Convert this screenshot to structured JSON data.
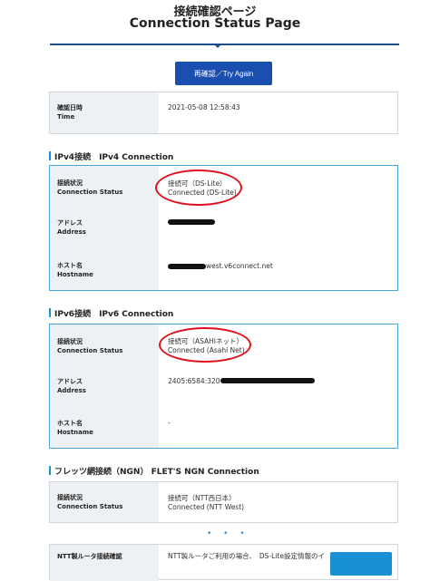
{
  "header": {
    "title_ja": "接続確認ページ",
    "title_en": "Connection Status Page"
  },
  "retry_button": {
    "label": "再確認／Try Again"
  },
  "datetime": {
    "label_ja": "確認日時",
    "label_en": "Time",
    "value": "2021-05-08 12:58:43"
  },
  "ipv4": {
    "section_title": "IPv4接続　IPv4 Connection",
    "status": {
      "label_ja": "接続状況",
      "label_en": "Connection Status",
      "value_ja": "接続可（DS-Lite）",
      "value_en": "Connected (DS-Lite)"
    },
    "address": {
      "label_ja": "アドレス",
      "label_en": "Address",
      "value": ""
    },
    "host": {
      "label_ja": "ホスト名",
      "label_en": "Hostname",
      "value_suffix": "west.v6connect.net"
    }
  },
  "ipv6": {
    "section_title": "IPv6接続　IPv6 Connection",
    "status": {
      "label_ja": "接続状況",
      "label_en": "Connection Status",
      "value_ja": "接続可（ASAHIネット）",
      "value_en": "Connected (Asahi Net)"
    },
    "address": {
      "label_ja": "アドレス",
      "label_en": "Address",
      "value_prefix": "2405:6584:320"
    },
    "host": {
      "label_ja": "ホスト名",
      "label_en": "Hostname",
      "value": "-"
    }
  },
  "ngn": {
    "section_title": "フレッツ網接続（NGN）  FLET'S NGN Connection",
    "status": {
      "label_ja": "接続状況",
      "label_en": "Connection Status",
      "value_ja": "接続可（NTT西日本）",
      "value_en": "Connected (NTT West)"
    }
  },
  "ntt_router": {
    "label_ja": "NTT製ルータ接続確認",
    "value": "NTT製ルータご利用の場合、　DS-Lite設定情報のイ"
  },
  "dots": "• • •",
  "colors": {
    "accent": "#1a4fb0",
    "section_bar": "#1a8fd6",
    "annotation": "#e0101a"
  }
}
